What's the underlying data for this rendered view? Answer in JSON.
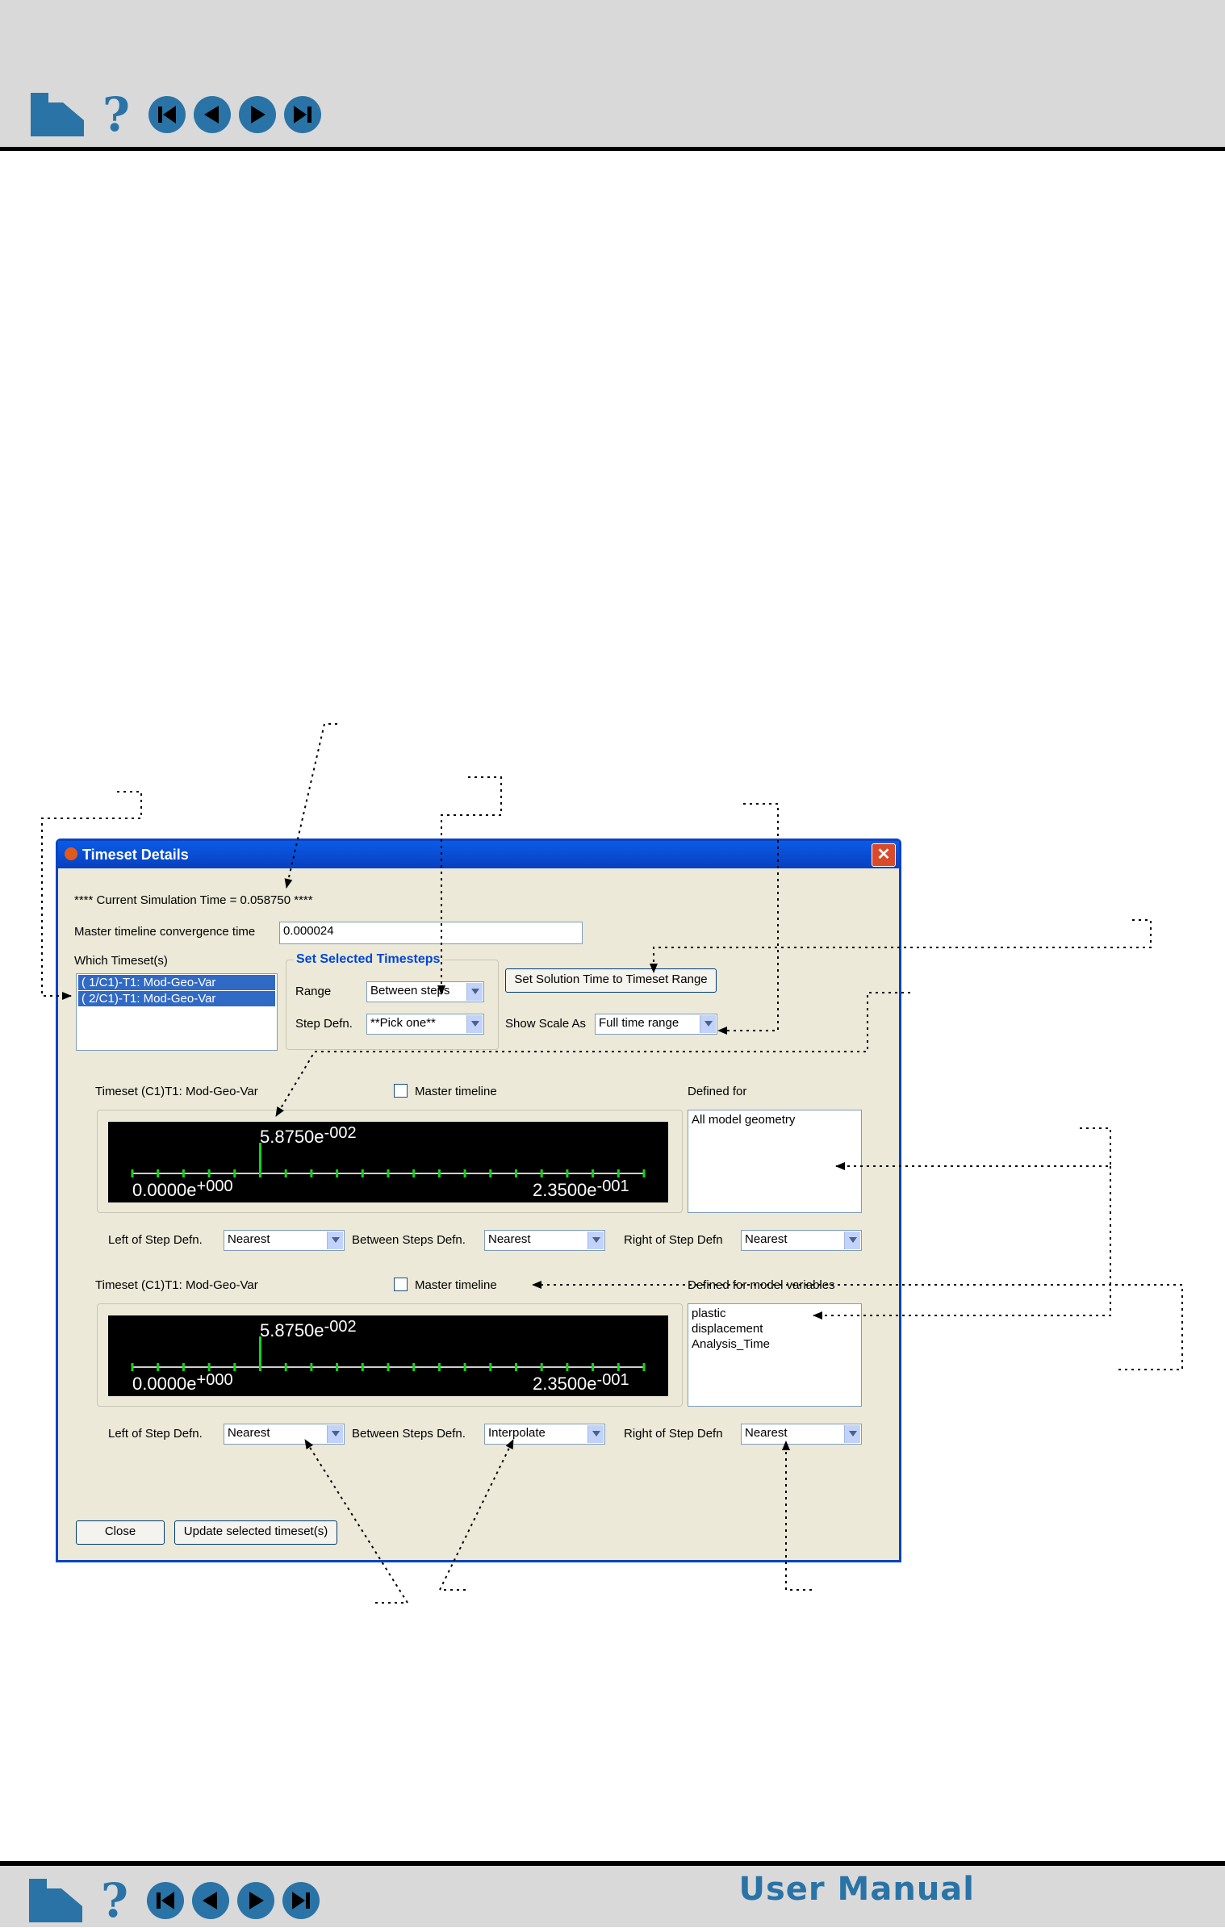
{
  "footer": {
    "manual_title": "User Manual"
  },
  "nav_icons": [
    "home-icon",
    "help-icon",
    "first-page-icon",
    "previous-page-icon",
    "next-page-icon",
    "last-page-icon"
  ],
  "dialog": {
    "title": "Timeset Details",
    "current_time": "**** Current Simulation Time = 0.058750 ****",
    "convergence_label": "Master timeline convergence time",
    "convergence_value": "0.000024",
    "which_label": "Which Timeset(s)",
    "timesets": [
      "( 1/C1)-T1: Mod-Geo-Var",
      "( 2/C1)-T1: Mod-Geo-Var"
    ],
    "group_title": "Set Selected Timesteps",
    "range_label": "Range",
    "range_value": "Between steps",
    "step_defn_label": "Step Defn.",
    "step_defn_value": "**Pick one**",
    "set_solution_button": "Set Solution Time to Timeset Range",
    "show_scale_label": "Show Scale As",
    "show_scale_value": "Full time range",
    "close_button": "Close",
    "update_button": "Update selected timeset(s)"
  },
  "panels": [
    {
      "timeset_label": "Timeset (C1)T1: Mod-Geo-Var",
      "master_label": "Master timeline",
      "defined_label": "Defined for",
      "defined_items": [
        "All model geometry"
      ],
      "tl_current_mantissa": "5.8750e",
      "tl_current_exp": "-002",
      "tl_start_mantissa": "0.0000e",
      "tl_start_exp": "+000",
      "tl_end_mantissa": "2.3500e",
      "tl_end_exp": "-001",
      "left_label": "Left of Step Defn.",
      "left_value": "Nearest",
      "between_label": "Between Steps Defn.",
      "between_value": "Nearest",
      "right_label": "Right of Step Defn",
      "right_value": "Nearest"
    },
    {
      "timeset_label": "Timeset (C1)T1: Mod-Geo-Var",
      "master_label": "Master timeline",
      "defined_label": "Defined for model variables",
      "defined_items": [
        "plastic",
        "displacement",
        "Analysis_Time"
      ],
      "tl_current_mantissa": "5.8750e",
      "tl_current_exp": "-002",
      "tl_start_mantissa": "0.0000e",
      "tl_start_exp": "+000",
      "tl_end_mantissa": "2.3500e",
      "tl_end_exp": "-001",
      "left_label": "Left of Step Defn.",
      "left_value": "Nearest",
      "between_label": "Between Steps Defn.",
      "between_value": "Interpolate",
      "right_label": "Right of Step Defn",
      "right_value": "Nearest"
    }
  ],
  "timeline": {
    "start": 0.0,
    "end": 0.235,
    "current": 0.05875,
    "tick_count": 21,
    "color": "#17d11c"
  }
}
